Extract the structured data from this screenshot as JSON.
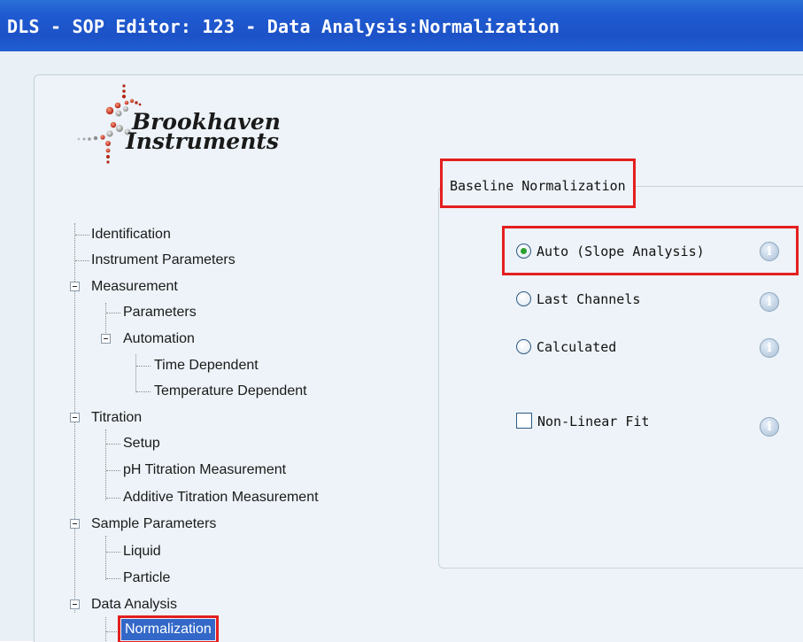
{
  "window": {
    "title": "DLS - SOP Editor: 123 - Data Analysis:Normalization"
  },
  "logo": {
    "line1": "Brookhaven",
    "line2": "Instruments"
  },
  "tree": {
    "identification": "Identification",
    "instrument_parameters": "Instrument Parameters",
    "measurement": "Measurement",
    "parameters": "Parameters",
    "automation": "Automation",
    "time_dependent": "Time Dependent",
    "temperature_dependent": "Temperature Dependent",
    "titration": "Titration",
    "setup": "Setup",
    "ph_titration": "pH Titration Measurement",
    "additive_titration": "Additive Titration Measurement",
    "sample_parameters": "Sample Parameters",
    "liquid": "Liquid",
    "particle": "Particle",
    "data_analysis": "Data Analysis",
    "normalization": "Normalization"
  },
  "baseline": {
    "group_label": "Baseline Normalization",
    "auto_label": "Auto (Slope Analysis)",
    "last_channels_label": "Last Channels",
    "calculated_label": "Calculated",
    "nonlinear_label": "Non-Linear Fit",
    "selected": "auto"
  },
  "colors": {
    "accent": "#3368c8",
    "highlight": "#e41f1f",
    "titlebar": "#1f5ad0"
  },
  "icons": {
    "info": "info-icon",
    "expander": "minus-box-icon"
  }
}
